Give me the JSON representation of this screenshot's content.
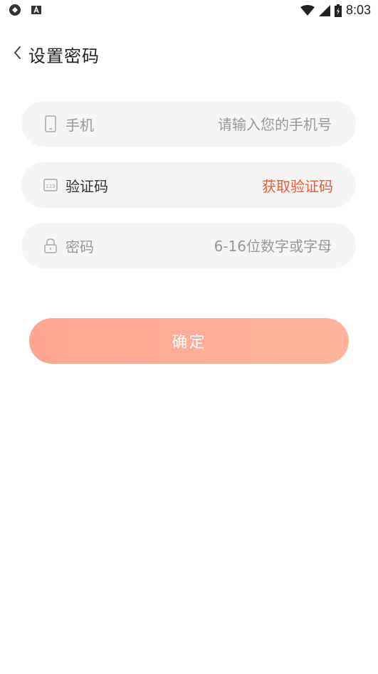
{
  "status_bar": {
    "time": "8:03",
    "icons": [
      "notification-icon",
      "a-icon",
      "wifi-icon",
      "signal-icon",
      "battery-icon"
    ]
  },
  "header": {
    "title": "设置密码"
  },
  "form": {
    "phone": {
      "label": "手机",
      "placeholder": "请输入您的手机号",
      "icon": "phone-icon"
    },
    "code": {
      "label": "验证码",
      "action": "获取验证码",
      "icon": "code-icon"
    },
    "password": {
      "label": "密码",
      "placeholder": "6-16位数字或字母",
      "icon": "lock-icon"
    }
  },
  "confirm": {
    "label": "确定"
  },
  "colors": {
    "accent": "#f0582f",
    "button_start": "#ffa591",
    "button_end": "#ffb49b",
    "field_bg": "#f5f5f5"
  }
}
